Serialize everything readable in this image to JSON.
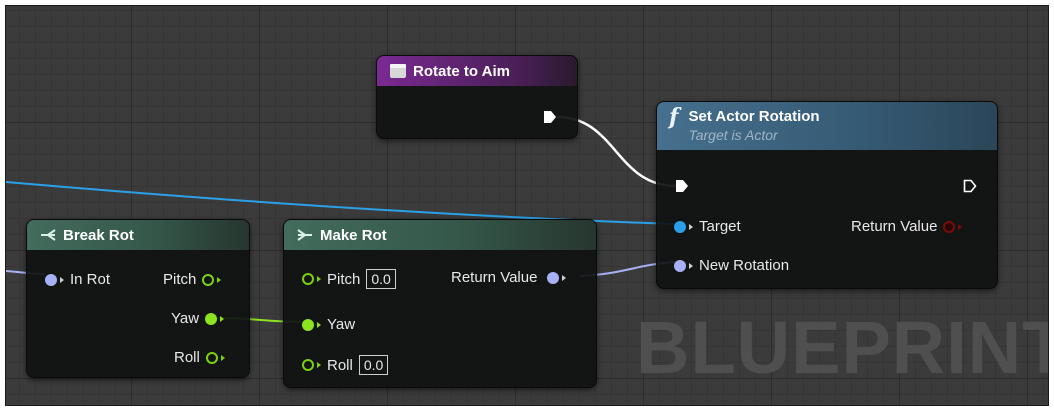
{
  "watermark": "BLUEPRINT",
  "nodes": {
    "rotate_to_aim": {
      "title": "Rotate to Aim"
    },
    "set_actor_rotation": {
      "title": "Set Actor Rotation",
      "subtitle": "Target is Actor",
      "pins": {
        "target": "Target",
        "new_rotation": "New Rotation",
        "return_value": "Return Value"
      }
    },
    "break_rot": {
      "title": "Break Rot",
      "pins": {
        "in_rot": "In Rot",
        "pitch": "Pitch",
        "yaw": "Yaw",
        "roll": "Roll"
      }
    },
    "make_rot": {
      "title": "Make Rot",
      "pins": {
        "pitch": "Pitch",
        "pitch_value": "0.0",
        "yaw": "Yaw",
        "roll": "Roll",
        "roll_value": "0.0",
        "return_value": "Return Value"
      }
    }
  },
  "colors": {
    "rotator_pin": "#a7b1f6",
    "object_pin": "#2aa0e8",
    "float_pin": "#8ce320",
    "exec_wire": "#ffffff",
    "event_header": "#7a2a92",
    "function_header": "#46708e",
    "pure_header": "#436c5d"
  }
}
